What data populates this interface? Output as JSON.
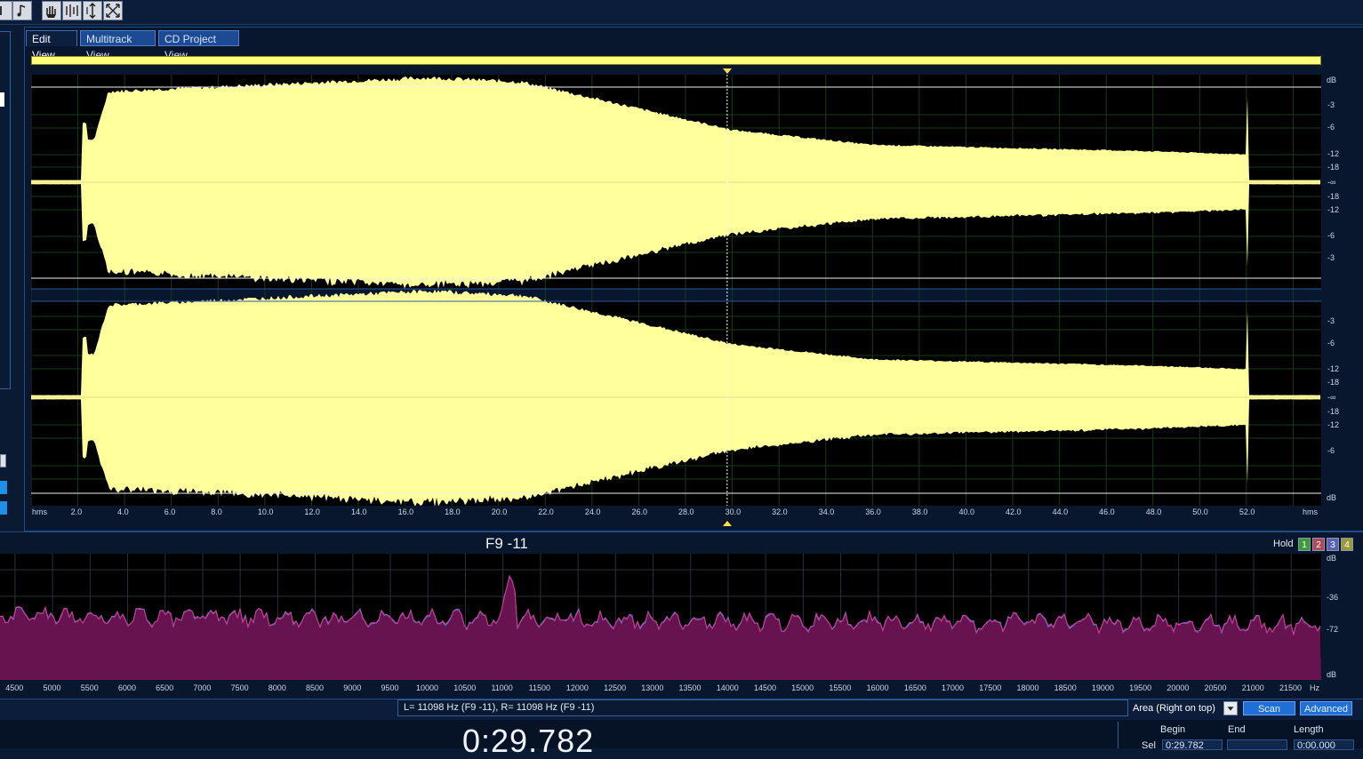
{
  "tabs": [
    {
      "label": "Edit View",
      "active": true
    },
    {
      "label": "Multitrack View",
      "active": false
    },
    {
      "label": "CD Project View",
      "active": false
    }
  ],
  "waveform": {
    "db_label_top": "dB",
    "db_label_bottom": "dB",
    "db_scale_ch1": [
      "-3",
      "-6",
      "-12",
      "-18",
      "-∞",
      "-18",
      "-12",
      "-6",
      "-3"
    ],
    "db_scale_ch2": [
      "-3",
      "-6",
      "-12",
      "-18",
      "-∞",
      "-18",
      "-12",
      "-6"
    ],
    "time_unit_left": "hms",
    "time_unit_right": "hms",
    "time_ticks": [
      "2.0",
      "4.0",
      "6.0",
      "8.0",
      "10.0",
      "12.0",
      "14.0",
      "16.0",
      "18.0",
      "20.0",
      "22.0",
      "24.0",
      "26.0",
      "28.0",
      "30.0",
      "32.0",
      "34.0",
      "36.0",
      "38.0",
      "40.0",
      "42.0",
      "44.0",
      "46.0",
      "48.0",
      "50.0",
      "52.0"
    ],
    "cursor_time_seconds": 29.782,
    "duration_seconds": 55.2,
    "colors": {
      "wave": "#ffff9c",
      "background": "#000000",
      "grid": "#1b3a1b"
    }
  },
  "spectrum": {
    "title": "F9 -11",
    "hold_label": "Hold",
    "hold_buttons": [
      {
        "label": "1",
        "color": "#3d9a3d"
      },
      {
        "label": "2",
        "color": "#b04a5a"
      },
      {
        "label": "3",
        "color": "#5a62b8"
      },
      {
        "label": "4",
        "color": "#9a9a3a"
      }
    ],
    "db_label_top": "dB",
    "db_label_bottom": "dB",
    "db_scale": [
      "-36",
      "-72"
    ],
    "freq_ticks": [
      "4500",
      "5000",
      "5500",
      "6000",
      "6500",
      "7000",
      "7500",
      "8000",
      "8500",
      "9000",
      "9500",
      "10000",
      "10500",
      "11000",
      "11500",
      "12000",
      "12500",
      "13000",
      "13500",
      "14000",
      "14500",
      "15000",
      "15500",
      "16000",
      "16500",
      "17000",
      "17500",
      "18000",
      "18500",
      "19000",
      "19500",
      "20000",
      "20500",
      "21000",
      "21500"
    ],
    "freq_unit": "Hz",
    "peak_hz": 11098,
    "colors": {
      "fill": "#66134f",
      "line_left": "#e0338f",
      "line_right": "#2f8fe0"
    }
  },
  "status": {
    "readout": "L=  11098 Hz (F9 -11), R=  11098 Hz (F9 -11)",
    "area_mode": "Area (Right on top)",
    "scan_label": "Scan",
    "advanced_label": "Advanced"
  },
  "time_display": "0:29.782",
  "selection": {
    "begin_label": "Begin",
    "end_label": "End",
    "length_label": "Length",
    "sel_label": "Sel",
    "begin_value": "0:29.782",
    "end_value": "",
    "length_value": "0:00.000"
  }
}
